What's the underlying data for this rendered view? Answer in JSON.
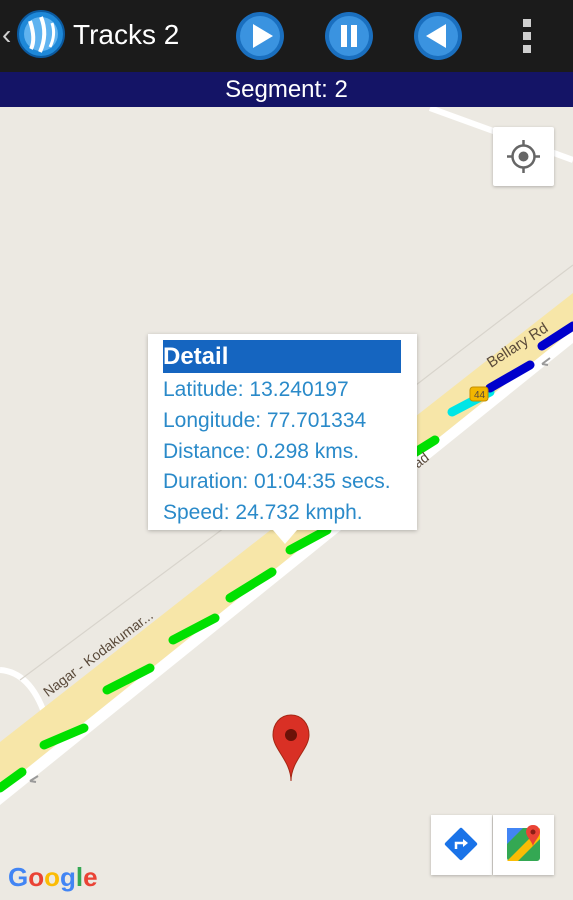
{
  "app": {
    "title": "Tracks 2",
    "back_glyph": "‹",
    "logo_icon": "track-logo-icon"
  },
  "controls": {
    "play_icon": "play-icon",
    "pause_icon": "pause-icon",
    "rewind_icon": "back-icon",
    "menu_icon": "more-vert-icon"
  },
  "segment": {
    "label": "Segment: 2"
  },
  "map": {
    "road_labels": [
      "Bellary Rd",
      "44",
      "ad",
      "Nagar - Kodakumar..."
    ],
    "google_letters": [
      "G",
      "o",
      "o",
      "g",
      "l",
      "e"
    ],
    "google_colors": [
      "#4285f4",
      "#ea4335",
      "#fbbc05",
      "#4285f4",
      "#34a853",
      "#ea4335"
    ],
    "route_colors": {
      "slow": "#00e000",
      "medium": "#00e6e6",
      "fast": "#0000cc"
    }
  },
  "popup": {
    "header": "Detail",
    "lines": [
      "Latitude: 13.240197",
      "Longitude: 77.701334",
      "Distance: 0.298 kms.",
      "Duration: 01:04:35 secs.",
      "Speed: 24.732 kmph."
    ]
  },
  "colors": {
    "toolbar": "#1b1b1b",
    "segment_bar": "#141466",
    "detail_header": "#1565c0",
    "detail_text": "#2a8ac9",
    "marker": "#d93025"
  }
}
